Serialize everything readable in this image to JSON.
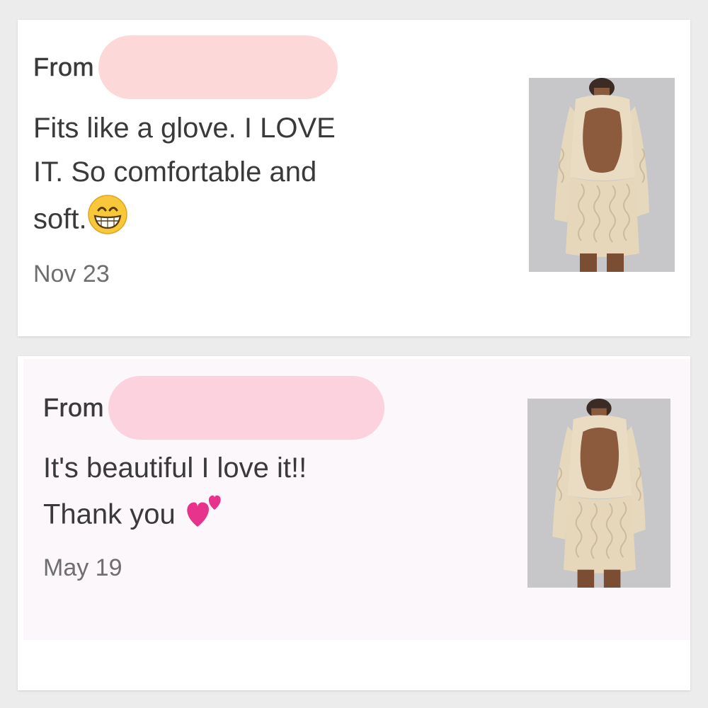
{
  "colors": {
    "redaction_1": "#fdd8d8",
    "redaction_2": "#fbd2de",
    "card_bg": "#ffffff",
    "card_2_tint": "#fbf7fa",
    "text": "#3a3a3a",
    "date": "#6e6e6e",
    "photo_bg": "#c9c9ca",
    "dress": "#e9dcc2"
  },
  "reviews": [
    {
      "from_label": "From",
      "text_lines": [
        "Fits like a glove. I LOVE",
        "IT. So comfortable and",
        "soft."
      ],
      "emoji": "grinning-face-with-smiling-eyes-icon",
      "date": "Nov 23",
      "photo": "open-back-cable-knit-sweater-dress"
    },
    {
      "from_label": "From",
      "text_lines": [
        "It's beautiful I love it!!",
        "Thank you"
      ],
      "emoji": "two-hearts-icon",
      "date": "May 19",
      "photo": "open-back-cable-knit-sweater-dress"
    }
  ]
}
